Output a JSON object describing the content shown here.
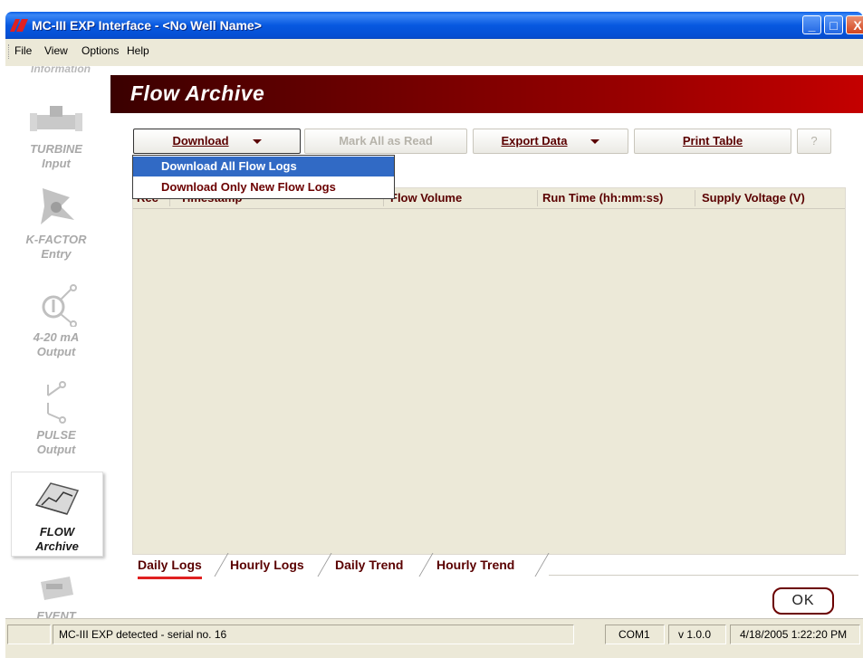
{
  "window": {
    "title": "MC-III EXP Interface - <No Well Name>",
    "minimize_glyph": "_",
    "maximize_glyph": "□",
    "close_glyph": "X"
  },
  "menu": [
    "File",
    "View",
    "Options",
    "Help"
  ],
  "sidebar": {
    "partial_label": "Information",
    "items": [
      {
        "title": "TURBINE",
        "sub": "Input",
        "icon": "turbine-icon"
      },
      {
        "title": "K-FACTOR",
        "sub": "Entry",
        "icon": "k-factor-icon"
      },
      {
        "title": "4-20 mA",
        "sub": "Output",
        "icon": "analog-output-icon"
      },
      {
        "title": "PULSE",
        "sub": "Output",
        "icon": "pulse-switch-icon"
      },
      {
        "title": "FLOW",
        "sub": "Archive",
        "icon": "flow-chart-icon",
        "active": true
      },
      {
        "title": "EVENT",
        "sub": "",
        "icon": "event-icon"
      }
    ]
  },
  "page_title": "Flow Archive",
  "toolbar": {
    "download": "Download",
    "mark_all": "Mark All as Read",
    "export": "Export Data",
    "print": "Print Table",
    "help": "?"
  },
  "download_menu": [
    "Download All Flow Logs",
    "Download Only New Flow Logs"
  ],
  "table": {
    "columns": [
      "Rec",
      "Timestamp",
      "Flow Volume",
      "Run Time (hh:mm:ss)",
      "Supply Voltage (V)"
    ],
    "rows": []
  },
  "tabs": [
    "Daily Logs",
    "Hourly Logs",
    "Daily Trend",
    "Hourly Trend"
  ],
  "ok_label": "OK",
  "status": {
    "message": "MC-III EXP detected - serial no. 16",
    "port": "COM1",
    "version": "v 1.0.0",
    "datetime": "4/18/2005 1:22:20 PM"
  },
  "colors": {
    "titlebar": "#0758e0",
    "header_dark": "#3a0000",
    "header_bright": "#c40000",
    "accent_text": "#5a0000",
    "selection": "#316ac5",
    "table_bg": "#ece9d8"
  }
}
